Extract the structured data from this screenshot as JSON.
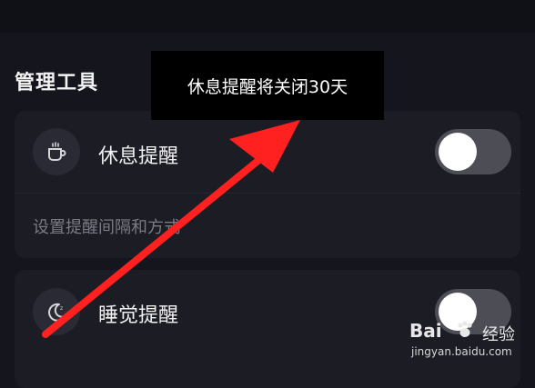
{
  "section": {
    "title": "管理工具"
  },
  "rest_reminder": {
    "label": "休息提醒",
    "description": "设置提醒间隔和方式",
    "enabled": false,
    "icon": "cup-icon"
  },
  "sleep_reminder": {
    "label": "睡觉提醒",
    "enabled": false,
    "icon": "moon-icon"
  },
  "toast": {
    "message": "休息提醒将关闭30天"
  },
  "watermark": {
    "brand": "Bai",
    "name": "经验",
    "url": "jingyan.baidu.com"
  },
  "colors": {
    "background": "#15151d",
    "card": "#1c1c25",
    "toggle_off": "#4d4d56",
    "arrow": "#ff2020",
    "toast_bg": "#000000"
  }
}
